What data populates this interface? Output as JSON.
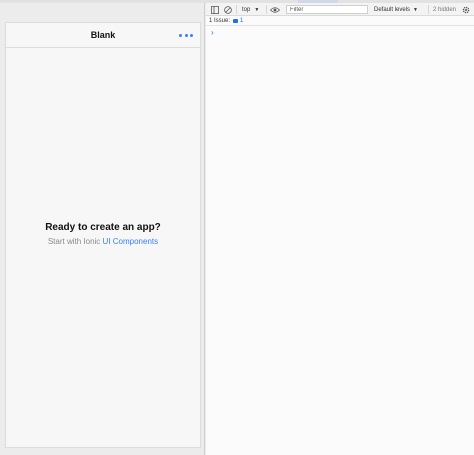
{
  "app": {
    "title": "Blank",
    "heading": "Ready to create an app?",
    "subtitle_prefix": "Start with Ionic",
    "subtitle_link": "UI Components",
    "accent_color": "#3880ff"
  },
  "console": {
    "context": "top",
    "filter_placeholder": "Filter",
    "levels": "Default levels",
    "hidden_count": "2 hidden",
    "issues_label": "1 Issue:",
    "issues_count": "1",
    "prompt": "›"
  },
  "icons": [
    "sidebar-toggle-icon",
    "clear-console-icon",
    "dropdown-arrow-icon",
    "eye-icon",
    "gear-icon",
    "more-icon",
    "message-icon"
  ]
}
